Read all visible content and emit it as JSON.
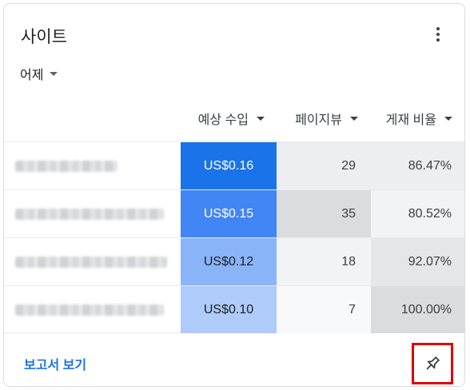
{
  "card": {
    "title": "사이트",
    "date_filter": "어제",
    "columns": [
      {
        "label": "예상 수입"
      },
      {
        "label": "페이지뷰"
      },
      {
        "label": "게재 비율"
      }
    ],
    "rows": [
      {
        "earnings": "US$0.16",
        "pageviews": "29",
        "fill_rate": "86.47%",
        "earnings_bg": "#1a73e8",
        "earnings_color": "#ffffff",
        "pageviews_bg": "#eceef1",
        "fill_bg": "#eceef1"
      },
      {
        "earnings": "US$0.15",
        "pageviews": "35",
        "fill_rate": "80.52%",
        "earnings_bg": "#4285f4",
        "earnings_color": "#ffffff",
        "pageviews_bg": "#dadce0",
        "fill_bg": "#f1f3f4"
      },
      {
        "earnings": "US$0.12",
        "pageviews": "18",
        "fill_rate": "92.07%",
        "earnings_bg": "#8ab4f8",
        "earnings_color": "#202124",
        "pageviews_bg": "#f1f3f4",
        "fill_bg": "#e4e6e9"
      },
      {
        "earnings": "US$0.10",
        "pageviews": "7",
        "fill_rate": "100.00%",
        "earnings_bg": "#aecbfa",
        "earnings_color": "#202124",
        "pageviews_bg": "#f8f9fa",
        "fill_bg": "#dadce0"
      }
    ],
    "footer_link": "보고서 보기",
    "icons": {
      "menu": "more-vert-icon",
      "pin": "pin-icon",
      "sort": "caret-down-icon"
    },
    "colors": {
      "accent": "#1a73e8",
      "highlight_box": "#e00000"
    }
  }
}
